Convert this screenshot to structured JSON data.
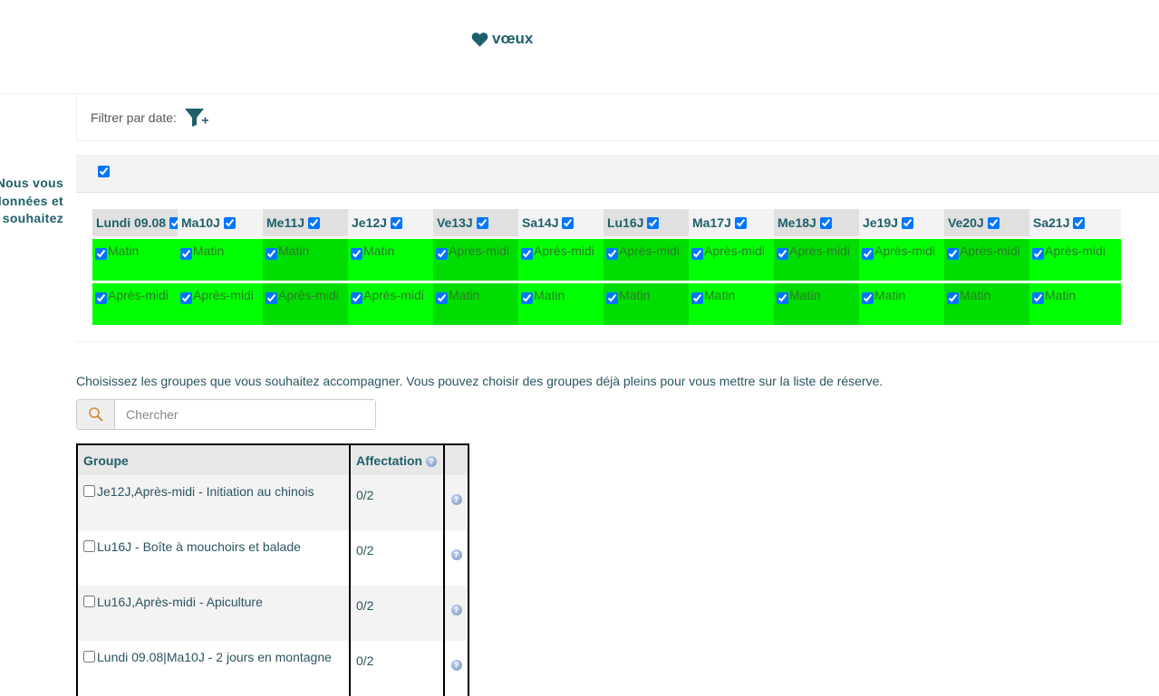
{
  "header": {
    "title": "vœux"
  },
  "filter": {
    "label": "Filtrer par date:",
    "icon": "filter-plus-icon"
  },
  "side_text": [
    "Nous vous",
    "données et",
    "souhaitez"
  ],
  "days": [
    {
      "label": "Lundi 09.08",
      "shade": "dark",
      "slot1": "Matin",
      "slot1_shade": "bright",
      "slot2": "Après-midi",
      "slot2_shade": "bright"
    },
    {
      "label": "Ma10J",
      "shade": "light",
      "slot1": "Matin",
      "slot1_shade": "bright",
      "slot2": "Après-midi",
      "slot2_shade": "bright"
    },
    {
      "label": "Me11J",
      "shade": "dark",
      "slot1": "Matin",
      "slot1_shade": "dark",
      "slot2": "Après-midi",
      "slot2_shade": "dark"
    },
    {
      "label": "Je12J",
      "shade": "light",
      "slot1": "Matin",
      "slot1_shade": "bright",
      "slot2": "Après-midi",
      "slot2_shade": "bright"
    },
    {
      "label": "Ve13J",
      "shade": "dark",
      "slot1": "Après-midi",
      "slot1_shade": "dark",
      "slot2": "Matin",
      "slot2_shade": "dark"
    },
    {
      "label": "Sa14J",
      "shade": "light",
      "slot1": "Après-midi",
      "slot1_shade": "bright",
      "slot2": "Matin",
      "slot2_shade": "bright"
    },
    {
      "label": "Lu16J",
      "shade": "dark",
      "slot1": "Après-midi",
      "slot1_shade": "dark",
      "slot2": "Matin",
      "slot2_shade": "dark"
    },
    {
      "label": "Ma17J",
      "shade": "light",
      "slot1": "Après-midi",
      "slot1_shade": "bright",
      "slot2": "Matin",
      "slot2_shade": "bright"
    },
    {
      "label": "Me18J",
      "shade": "dark",
      "slot1": "Après-midi",
      "slot1_shade": "dark",
      "slot2": "Matin",
      "slot2_shade": "dark"
    },
    {
      "label": "Je19J",
      "shade": "light",
      "slot1": "Après-midi",
      "slot1_shade": "bright",
      "slot2": "Matin",
      "slot2_shade": "bright"
    },
    {
      "label": "Ve20J",
      "shade": "dark",
      "slot1": "Après-midi",
      "slot1_shade": "dark",
      "slot2": "Matin",
      "slot2_shade": "dark"
    },
    {
      "label": "Sa21J",
      "shade": "light",
      "slot1": "Après-midi",
      "slot1_shade": "bright",
      "slot2": "Matin",
      "slot2_shade": "bright"
    }
  ],
  "description": "Choisissez les groupes que vous souhaitez accompagner. Vous pouvez choisir des groupes déjà pleins pour vous mettre sur la liste de réserve.",
  "search": {
    "placeholder": "Chercher"
  },
  "table": {
    "headers": {
      "group": "Groupe",
      "affectation": "Affectation"
    },
    "rows": [
      {
        "group": "Je12J,Après-midi - Initiation au chinois",
        "affectation": "0/2"
      },
      {
        "group": "Lu16J - Boîte à mouchoirs et balade",
        "affectation": "0/2"
      },
      {
        "group": "Lu16J,Après-midi - Apiculture",
        "affectation": "0/2"
      },
      {
        "group": "Lundi 09.08|Ma10J - 2 jours en montagne",
        "affectation": "0/2"
      }
    ]
  },
  "colors": {
    "accent": "#1e5f6b",
    "slot_bright": "#00ff00",
    "slot_dark": "#00dd00"
  }
}
